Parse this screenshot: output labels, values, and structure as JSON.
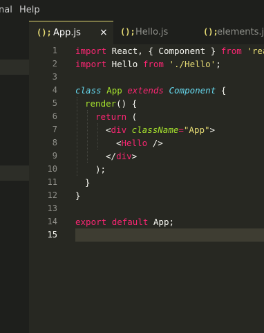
{
  "menu": {
    "item1": "nal",
    "item2": "Help"
  },
  "tabs": [
    {
      "icon": "();",
      "label": "App.js",
      "close": "×"
    },
    {
      "icon": "();",
      "label": "Hello.js"
    },
    {
      "icon": "();",
      "label": "elements.js"
    }
  ],
  "line_numbers": [
    "1",
    "2",
    "3",
    "4",
    "5",
    "6",
    "7",
    "8",
    "9",
    "10",
    "11",
    "12",
    "13",
    "14",
    "15"
  ],
  "code": {
    "l1": {
      "a": "import",
      "b": " React, { Component } ",
      "c": "from",
      "d": " 'react"
    },
    "l2": {
      "a": "import",
      "b": " Hello ",
      "c": "from",
      "d": " './Hello'",
      "e": ";"
    },
    "l4": {
      "a": "class",
      "b": " App ",
      "c": "extends",
      "d": " Component",
      "e": " {"
    },
    "l5": {
      "a": "render",
      "b": "() {"
    },
    "l6": {
      "a": "return",
      "b": " ("
    },
    "l7": {
      "a": "<",
      "b": "div",
      "c": " className",
      "d": "=",
      "e": "\"App\"",
      "f": ">"
    },
    "l8": {
      "a": "<",
      "b": "Hello",
      "c": " />"
    },
    "l9": {
      "a": "</",
      "b": "div",
      "c": ">"
    },
    "l10": {
      "a": ");"
    },
    "l11": {
      "a": "}"
    },
    "l12": {
      "a": "}"
    },
    "l14": {
      "a": "export",
      "b": " ",
      "c": "default",
      "d": " App",
      "e": ";"
    }
  }
}
